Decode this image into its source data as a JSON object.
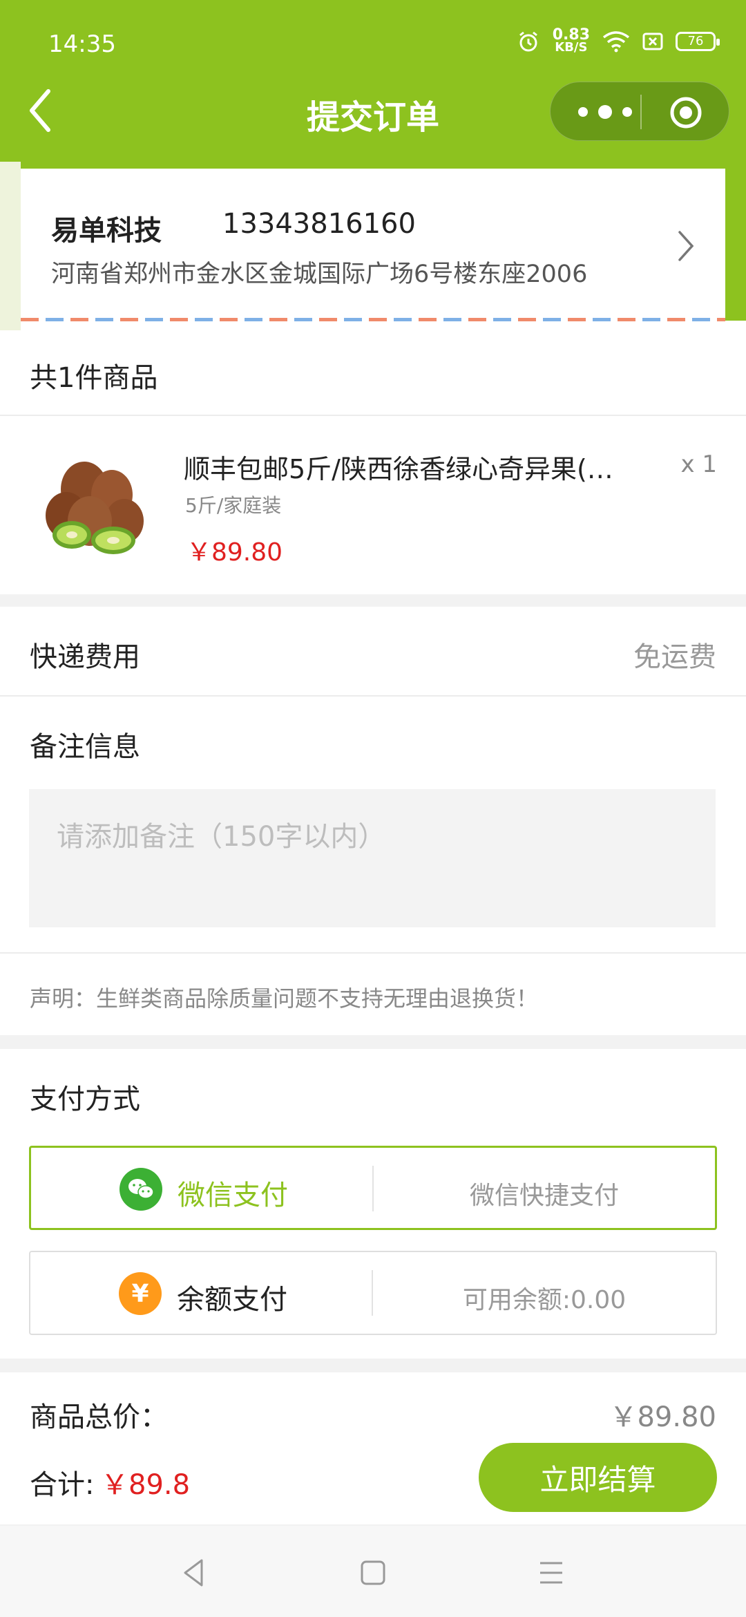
{
  "status_bar": {
    "time": "14:35",
    "net_speed_value": "0.83",
    "net_speed_unit": "KB/S",
    "battery": "76",
    "icons": [
      "alarm-icon",
      "wifi-icon",
      "sim-icon",
      "battery-icon"
    ]
  },
  "header": {
    "title": "提交订单",
    "accent_color": "#8dc21f"
  },
  "address": {
    "name": "易单科技",
    "phone": "13343816160",
    "detail": "河南省郑州市金水区金城国际广场6号楼东座2006"
  },
  "goods": {
    "count_label": "共1件商品",
    "items": [
      {
        "name": "顺丰包邮5斤/陕西徐香绿心奇异果(…",
        "spec": "5斤/家庭装",
        "price": "￥89.80",
        "qty": "x 1"
      }
    ]
  },
  "shipping": {
    "label": "快递费用",
    "value": "免运费"
  },
  "remark": {
    "label": "备注信息",
    "placeholder": "请添加备注（150字以内）",
    "value": ""
  },
  "notice": "声明：生鲜类商品除质量问题不支持无理由退换货！",
  "payment": {
    "label": "支付方式",
    "options": [
      {
        "name": "微信支付",
        "desc": "微信快捷支付",
        "selected": true,
        "icon": "wechat-icon",
        "icon_color": "#3cb034"
      },
      {
        "name": "余额支付",
        "desc": "可用余额:0.00",
        "selected": false,
        "icon": "yuan-icon",
        "icon_color": "#ff9a1a",
        "icon_glyph": "¥"
      }
    ]
  },
  "totals": {
    "goods_total_label": "商品总价：",
    "goods_total_value": "￥89.80"
  },
  "footer": {
    "sum_label": "合计:",
    "sum_value": "￥89.8",
    "checkout_label": "立即结算"
  }
}
